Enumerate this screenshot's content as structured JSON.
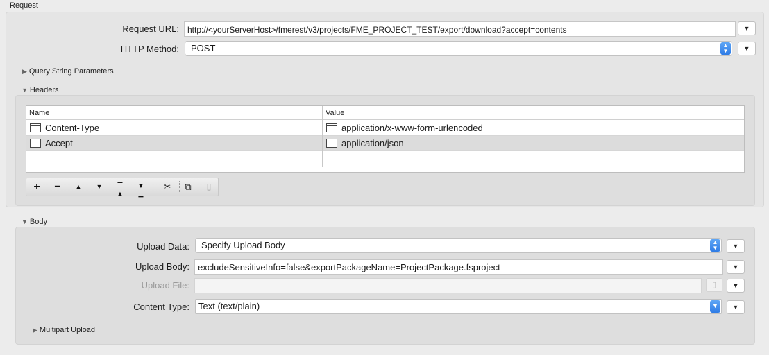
{
  "request": {
    "section_title": "Request",
    "url_label": "Request URL:",
    "url_value": "http://<yourServerHost>/fmerest/v3/projects/FME_PROJECT_TEST/export/download?accept=contents",
    "method_label": "HTTP Method:",
    "method_value": "POST",
    "query_string_label": "Query String Parameters",
    "headers_label": "Headers"
  },
  "headers_table": {
    "columns": [
      "Name",
      "Value"
    ],
    "rows": [
      {
        "name": "Content-Type",
        "value": "application/x-www-form-urlencoded"
      },
      {
        "name": "Accept",
        "value": "application/json"
      }
    ],
    "selected_row": 1
  },
  "toolbar": {
    "icons": [
      "plus-icon",
      "minus-icon",
      "move-up-icon",
      "move-down-icon",
      "move-to-top-icon",
      "move-to-bottom-icon",
      "cut-icon",
      "copy-icon",
      "paste-icon"
    ]
  },
  "body": {
    "section_title": "Body",
    "upload_data_label": "Upload Data:",
    "upload_data_value": "Specify Upload Body",
    "upload_body_label": "Upload Body:",
    "upload_body_value": "excludeSensitiveInfo=false&exportPackageName=ProjectPackage.fsproject",
    "upload_file_label": "Upload File:",
    "upload_file_value": "",
    "content_type_label": "Content Type:",
    "content_type_value": "Text (text/plain)",
    "multipart_label": "Multipart Upload"
  },
  "colors": {
    "background": "#ececec",
    "panel": "#e5e5e5",
    "accent_blue": "#2f7ce6",
    "selected_row": "#dcdcdc"
  }
}
